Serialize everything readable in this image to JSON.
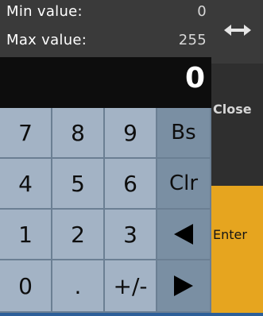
{
  "range": {
    "min_label": "Min value:",
    "min_value": "0",
    "max_label": "Max value:",
    "max_value": "255"
  },
  "display": {
    "value": "0"
  },
  "keys": {
    "k7": "7",
    "k8": "8",
    "k9": "9",
    "bs": "Bs",
    "k4": "4",
    "k5": "5",
    "k6": "6",
    "clr": "Clr",
    "k1": "1",
    "k2": "2",
    "k3": "3",
    "k0": "0",
    "dot": ".",
    "sign": "+/-"
  },
  "side": {
    "move_icon": "left-right-arrows-icon",
    "close_label": "Close",
    "enter_label": "Enter"
  },
  "colors": {
    "key_bg": "#a3b3c5",
    "op_key_bg": "#7a8fa3",
    "enter_bg": "#e6a51f",
    "display_bg": "#0d0d0d"
  }
}
